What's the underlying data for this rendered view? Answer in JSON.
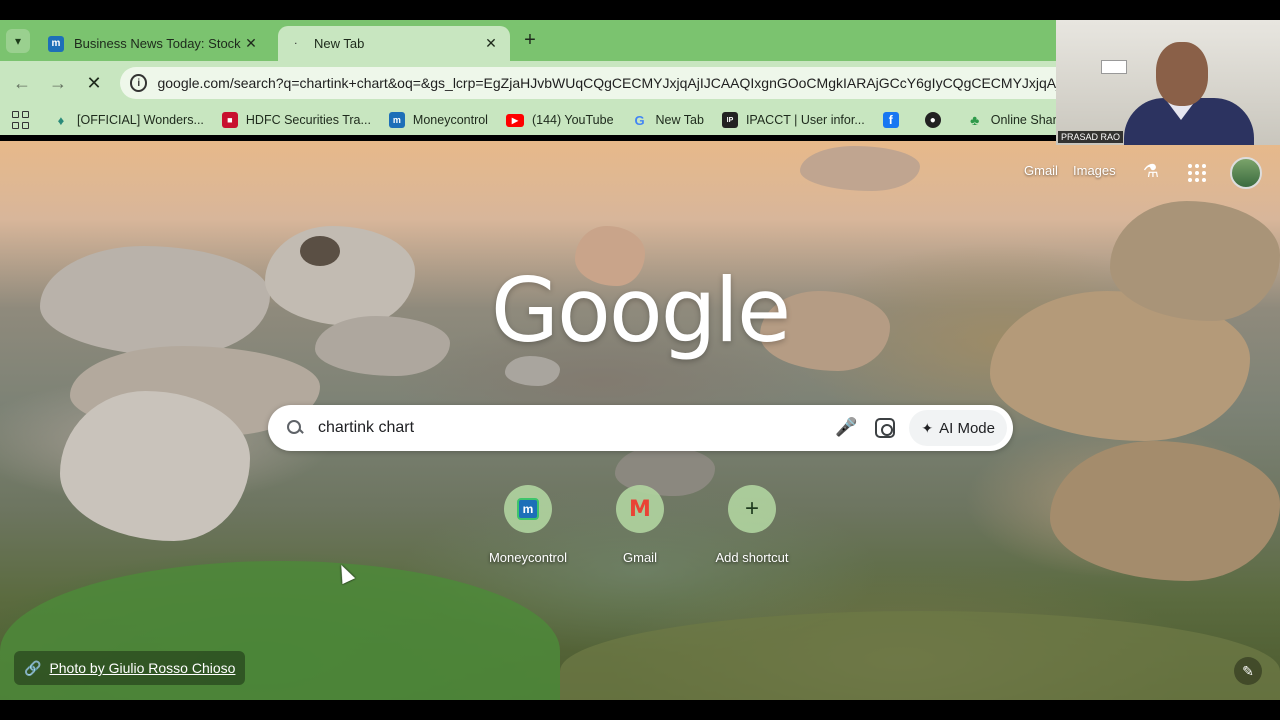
{
  "browser": {
    "tabs": [
      {
        "title": "Business News Today: Stock and",
        "active": false,
        "favicon": "moneycontrol-m-icon"
      },
      {
        "title": "New Tab",
        "active": true,
        "favicon": "loading-icon"
      }
    ],
    "address": "google.com/search?q=chartink+chart&oq=&gs_lcrp=EgZjaHJvbWUqCQgCECMYJxjqAjIJCAAQIxgnGOoCMgkIARAjGCcY6gIyCQgCECMYJxjqAjIPCA",
    "bookmarks": [
      {
        "label": "[OFFICIAL] Wonders...",
        "icon": "diamond-icon"
      },
      {
        "label": "HDFC Securities Tra...",
        "icon": "hdfc-icon"
      },
      {
        "label": "Moneycontrol",
        "icon": "moneycontrol-icon"
      },
      {
        "label": "(144) YouTube",
        "icon": "youtube-icon"
      },
      {
        "label": "New Tab",
        "icon": "google-g-icon"
      },
      {
        "label": "IPACCT | User infor...",
        "icon": "ipacct-icon"
      },
      {
        "label": "",
        "icon": "facebook-icon"
      },
      {
        "label": "",
        "icon": "globe-icon"
      },
      {
        "label": "Online Share Tradin...",
        "icon": "clover-icon"
      }
    ]
  },
  "newtab": {
    "header_links": {
      "gmail": "Gmail",
      "images": "Images"
    },
    "logo": "Google",
    "search_value": "chartink chart",
    "ai_mode_label": "AI Mode",
    "shortcuts": [
      {
        "label": "Moneycontrol",
        "icon": "moneycontrol-icon"
      },
      {
        "label": "Gmail",
        "icon": "gmail-icon"
      },
      {
        "label": "Add shortcut",
        "icon": "plus-icon"
      }
    ],
    "photo_credit": "Photo by Giulio Rosso Chioso"
  },
  "webcam": {
    "name": "PRASAD RAO"
  }
}
